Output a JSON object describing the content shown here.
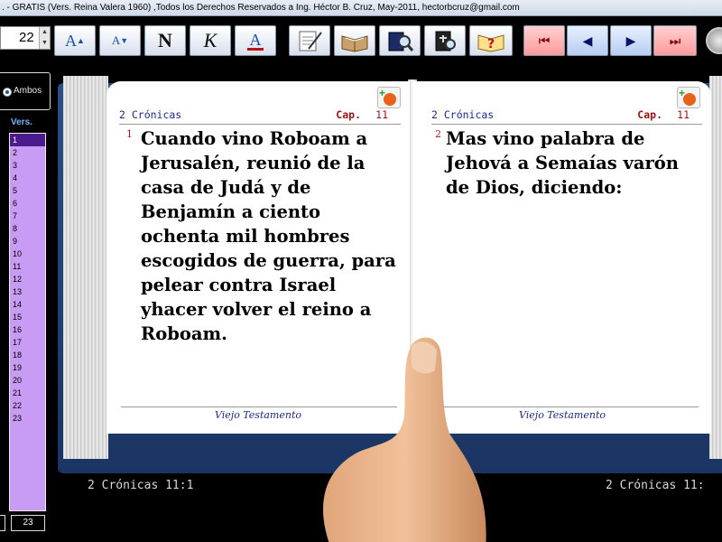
{
  "window": {
    "title": ". - GRATIS (Vers. Reina Valera 1960) ,Todos los Derechos Reservados  a Ing. Héctor B. Cruz, May-2011, hectorbcruz@gmail.com"
  },
  "toolbar": {
    "font_size": "22",
    "increase_label": "A",
    "decrease_label": "A",
    "normal_label": "N",
    "italic_label": "K",
    "color_label": "A"
  },
  "sidebar": {
    "mode_label": "Ambos",
    "verses_label": "Vers.",
    "verses": [
      "1",
      "2",
      "3",
      "4",
      "5",
      "6",
      "7",
      "8",
      "9",
      "10",
      "11",
      "12",
      "13",
      "14",
      "15",
      "16",
      "17",
      "18",
      "19",
      "20",
      "21",
      "22",
      "23"
    ],
    "selected_verse": "1",
    "count": "23"
  },
  "left_page": {
    "book": "2 Crónicas",
    "cap_label": "Cap.",
    "chapter": "11",
    "verse_number": "1",
    "verse_text": "Cuando vino Roboam a Jerusalén, reunió de la casa de Judá y de Benjamín a ciento ochenta mil hombres escogidos de guerra, para pelear contra Israel yhacer volver el reino a Roboam.",
    "footer": "Viejo Testamento"
  },
  "right_page": {
    "book": "2 Crónicas",
    "cap_label": "Cap.",
    "chapter": "11",
    "verse_number": "2",
    "verse_text": "Mas vino palabra de Jehová a Semaías varón de Dios, diciendo:",
    "footer": "Viejo Testamento"
  },
  "status": {
    "left_ref": "2 Crónicas 11:1",
    "right_ref": "2 Crónicas 11:"
  }
}
